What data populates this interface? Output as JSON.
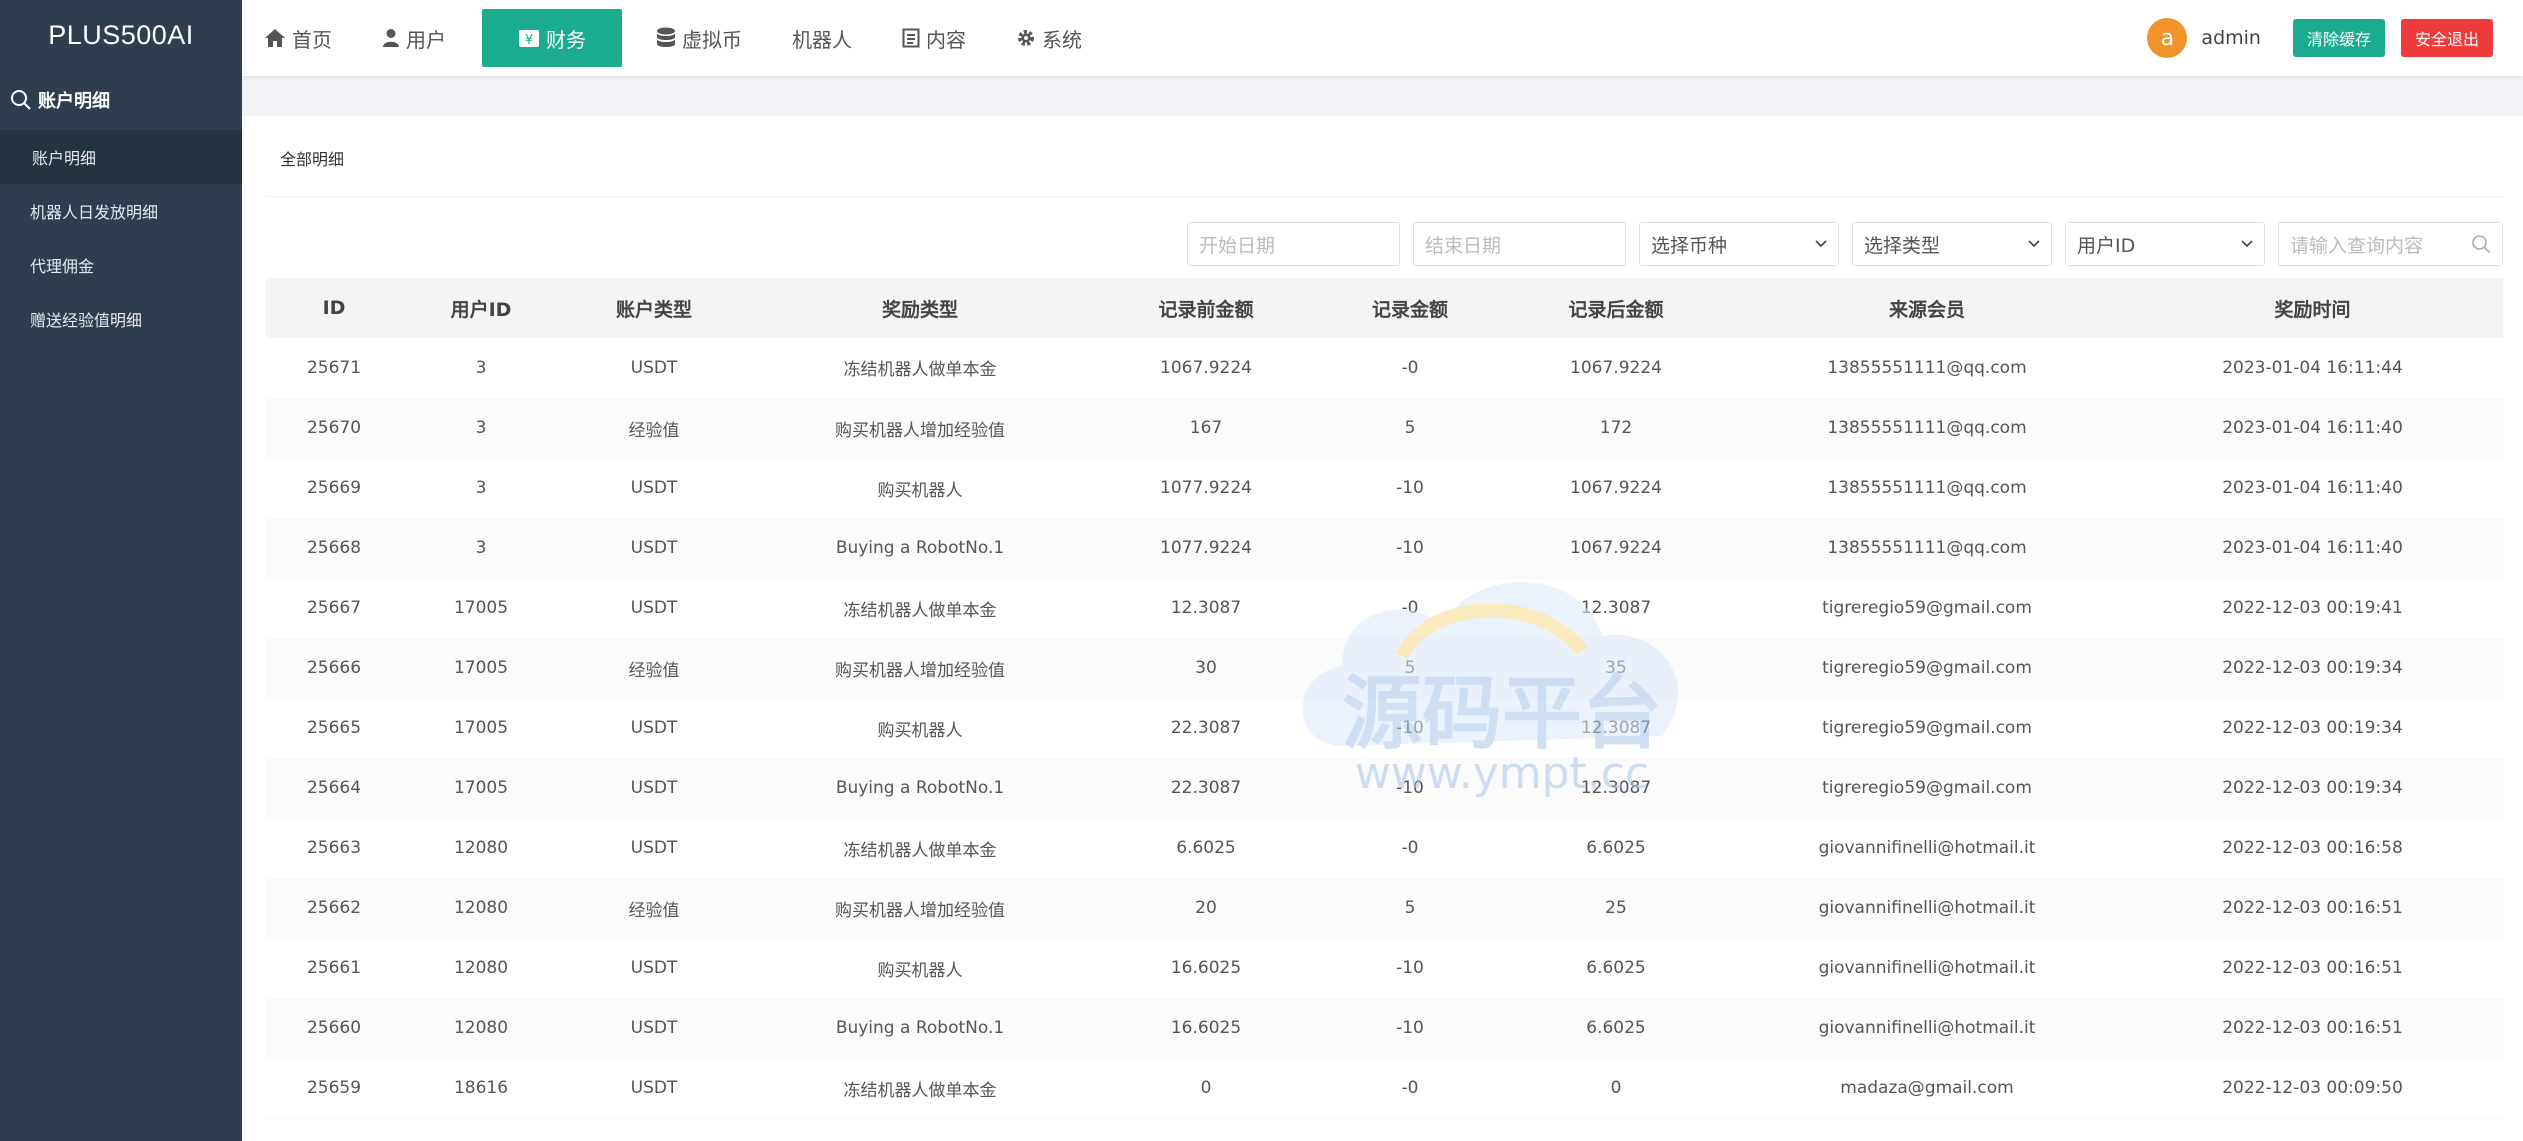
{
  "brand": "PLUS500AI",
  "sidebar": {
    "heading": "账户明细",
    "items": [
      {
        "label": "账户明细"
      },
      {
        "label": "机器人日发放明细"
      },
      {
        "label": "代理佣金"
      },
      {
        "label": "赠送经验值明细"
      }
    ]
  },
  "nav": {
    "items": [
      {
        "label": "首页",
        "icon": "home-icon"
      },
      {
        "label": "用户",
        "icon": "user-icon"
      },
      {
        "label": "财务",
        "icon": "finance-icon"
      },
      {
        "label": "虚拟币",
        "icon": "database-icon"
      },
      {
        "label": "机器人",
        "icon": ""
      },
      {
        "label": "内容",
        "icon": "document-icon"
      },
      {
        "label": "系统",
        "icon": "gear-icon"
      }
    ],
    "active_index": 2
  },
  "user": {
    "avatar_letter": "a",
    "name": "admin"
  },
  "buttons": {
    "clear_cache": "清除缓存",
    "logout": "安全退出"
  },
  "panel": {
    "title": "全部明细"
  },
  "filters": {
    "start_date_placeholder": "开始日期",
    "end_date_placeholder": "结束日期",
    "currency_select": "选择币种",
    "type_select": "选择类型",
    "user_id_select": "用户ID",
    "search_placeholder": "请输入查询内容"
  },
  "table": {
    "headers": [
      "ID",
      "用户ID",
      "账户类型",
      "奖励类型",
      "记录前金额",
      "记录金额",
      "记录后金额",
      "来源会员",
      "奖励时间"
    ],
    "rows": [
      [
        "25671",
        "3",
        "USDT",
        "冻结机器人做单本金",
        "1067.9224",
        "-0",
        "1067.9224",
        "13855551111@qq.com",
        "2023-01-04 16:11:44"
      ],
      [
        "25670",
        "3",
        "经验值",
        "购买机器人增加经验值",
        "167",
        "5",
        "172",
        "13855551111@qq.com",
        "2023-01-04 16:11:40"
      ],
      [
        "25669",
        "3",
        "USDT",
        "购买机器人",
        "1077.9224",
        "-10",
        "1067.9224",
        "13855551111@qq.com",
        "2023-01-04 16:11:40"
      ],
      [
        "25668",
        "3",
        "USDT",
        "Buying a RobotNo.1",
        "1077.9224",
        "-10",
        "1067.9224",
        "13855551111@qq.com",
        "2023-01-04 16:11:40"
      ],
      [
        "25667",
        "17005",
        "USDT",
        "冻结机器人做单本金",
        "12.3087",
        "-0",
        "12.3087",
        "tigreregio59@gmail.com",
        "2022-12-03 00:19:41"
      ],
      [
        "25666",
        "17005",
        "经验值",
        "购买机器人增加经验值",
        "30",
        "5",
        "35",
        "tigreregio59@gmail.com",
        "2022-12-03 00:19:34"
      ],
      [
        "25665",
        "17005",
        "USDT",
        "购买机器人",
        "22.3087",
        "-10",
        "12.3087",
        "tigreregio59@gmail.com",
        "2022-12-03 00:19:34"
      ],
      [
        "25664",
        "17005",
        "USDT",
        "Buying a RobotNo.1",
        "22.3087",
        "-10",
        "12.3087",
        "tigreregio59@gmail.com",
        "2022-12-03 00:19:34"
      ],
      [
        "25663",
        "12080",
        "USDT",
        "冻结机器人做单本金",
        "6.6025",
        "-0",
        "6.6025",
        "giovannifinelli@hotmail.it",
        "2022-12-03 00:16:58"
      ],
      [
        "25662",
        "12080",
        "经验值",
        "购买机器人增加经验值",
        "20",
        "5",
        "25",
        "giovannifinelli@hotmail.it",
        "2022-12-03 00:16:51"
      ],
      [
        "25661",
        "12080",
        "USDT",
        "购买机器人",
        "16.6025",
        "-10",
        "6.6025",
        "giovannifinelli@hotmail.it",
        "2022-12-03 00:16:51"
      ],
      [
        "25660",
        "12080",
        "USDT",
        "Buying a RobotNo.1",
        "16.6025",
        "-10",
        "6.6025",
        "giovannifinelli@hotmail.it",
        "2022-12-03 00:16:51"
      ],
      [
        "25659",
        "18616",
        "USDT",
        "冻结机器人做单本金",
        "0",
        "-0",
        "0",
        "madaza@gmail.com",
        "2022-12-03 00:09:50"
      ]
    ]
  },
  "watermark": {
    "text": "源码平台",
    "url": "www.ympt.cc"
  },
  "colors": {
    "sidebar": "#2f3e4e",
    "accent": "#1bab8f",
    "danger": "#ef3b3b",
    "avatar": "#f0932b"
  }
}
